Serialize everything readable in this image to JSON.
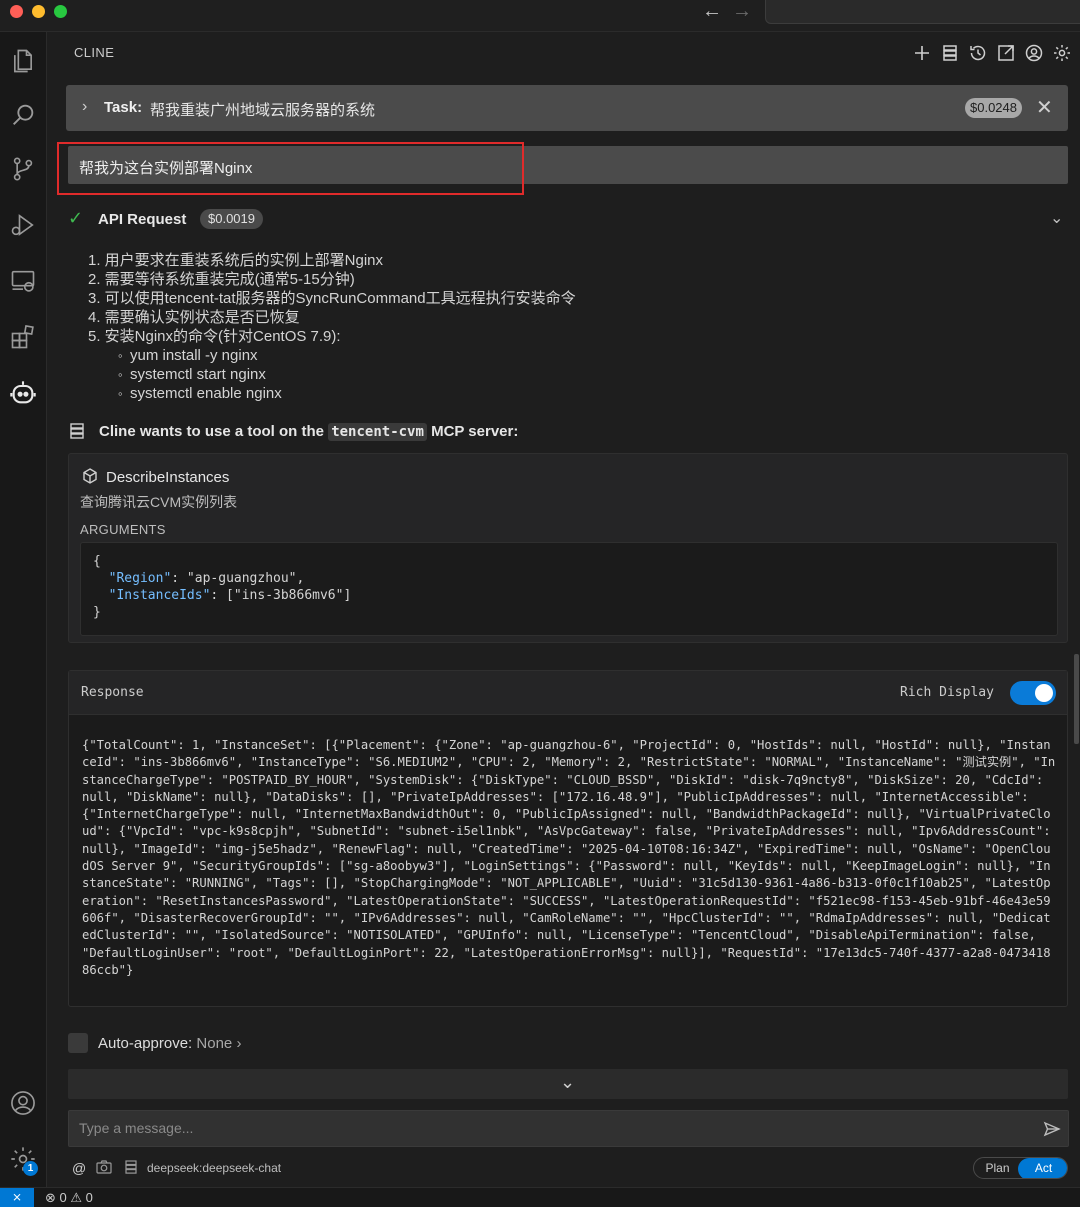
{
  "titlebar": {
    "back": "←",
    "forward": "→"
  },
  "activity_badge": "1",
  "panel": {
    "title": "CLINE"
  },
  "task": {
    "label": "Task:",
    "text": "帮我重装广州地域云服务器的系统",
    "cost": "$0.0248",
    "close": "✕"
  },
  "user_message": "帮我为这台实例部署Nginx",
  "api_request": {
    "label": "API Request",
    "cost": "$0.0019"
  },
  "steps": [
    "1. 用户要求在重装系统后的实例上部署Nginx",
    "2. 需要等待系统重装完成(通常5-15分钟)",
    "3. 可以使用tencent-tat服务器的SyncRunCommand工具远程执行安装命令",
    "4. 需要确认实例状态是否已恢复",
    "5. 安装Nginx的命令(针对CentOS 7.9):"
  ],
  "sub_steps": [
    "yum install -y nginx",
    "systemctl start nginx",
    "systemctl enable nginx"
  ],
  "tool_request": {
    "prefix": "Cline wants to use a tool on the",
    "server": "tencent-cvm",
    "suffix": "MCP server:"
  },
  "tool": {
    "name": "DescribeInstances",
    "description": "查询腾讯云CVM实例列表",
    "arguments_label": "ARGUMENTS",
    "arg_open": "{",
    "arg_close": "}",
    "arg1_key": "\"Region\"",
    "arg1_val": ": \"ap-guangzhou\",",
    "arg2_key": "\"InstanceIds\"",
    "arg2_val": ": [\"ins-3b866mv6\"]"
  },
  "response": {
    "title": "Response",
    "rich_display_label": "Rich Display",
    "rich_display_on": true,
    "body": "{\"TotalCount\": 1, \"InstanceSet\": [{\"Placement\": {\"Zone\": \"ap-guangzhou-6\", \"ProjectId\": 0, \"HostIds\": null, \"HostId\": null}, \"InstanceId\": \"ins-3b866mv6\", \"InstanceType\": \"S6.MEDIUM2\", \"CPU\": 2, \"Memory\": 2, \"RestrictState\": \"NORMAL\", \"InstanceName\": \"测试实例\", \"InstanceChargeType\": \"POSTPAID_BY_HOUR\", \"SystemDisk\": {\"DiskType\": \"CLOUD_BSSD\", \"DiskId\": \"disk-7q9ncty8\", \"DiskSize\": 20, \"CdcId\": null, \"DiskName\": null}, \"DataDisks\": [], \"PrivateIpAddresses\": [\"172.16.48.9\"], \"PublicIpAddresses\": null, \"InternetAccessible\": {\"InternetChargeType\": null, \"InternetMaxBandwidthOut\": 0, \"PublicIpAssigned\": null, \"BandwidthPackageId\": null}, \"VirtualPrivateCloud\": {\"VpcId\": \"vpc-k9s8cpjh\", \"SubnetId\": \"subnet-i5el1nbk\", \"AsVpcGateway\": false, \"PrivateIpAddresses\": null, \"Ipv6AddressCount\": null}, \"ImageId\": \"img-j5e5hadz\", \"RenewFlag\": null, \"CreatedTime\": \"2025-04-10T08:16:34Z\", \"ExpiredTime\": null, \"OsName\": \"OpenCloudOS Server 9\", \"SecurityGroupIds\": [\"sg-a8oobyw3\"], \"LoginSettings\": {\"Password\": null, \"KeyIds\": null, \"KeepImageLogin\": null}, \"InstanceState\": \"RUNNING\", \"Tags\": [], \"StopChargingMode\": \"NOT_APPLICABLE\", \"Uuid\": \"31c5d130-9361-4a86-b313-0f0c1f10ab25\", \"LatestOperation\": \"ResetInstancesPassword\", \"LatestOperationState\": \"SUCCESS\", \"LatestOperationRequestId\": \"f521ec98-f153-45eb-91bf-46e43e59606f\", \"DisasterRecoverGroupId\": \"\", \"IPv6Addresses\": null, \"CamRoleName\": \"\", \"HpcClusterId\": \"\", \"RdmaIpAddresses\": null, \"DedicatedClusterId\": \"\", \"IsolatedSource\": \"NOTISOLATED\", \"GPUInfo\": null, \"LicenseType\": \"TencentCloud\", \"DisableApiTermination\": false, \"DefaultLoginUser\": \"root\", \"DefaultLoginPort\": 22, \"LatestOperationErrorMsg\": null}], \"RequestId\": \"17e13dc5-740f-4377-a2a8-047341886ccb\"}"
  },
  "auto_approve": {
    "label": "Auto-approve:",
    "value": "None",
    "chevron": "›"
  },
  "scroll_chevron": "⌄",
  "input": {
    "placeholder": "Type a message..."
  },
  "footer": {
    "at": "@",
    "model": "deepseek:deepseek-chat",
    "plan": "Plan",
    "act": "Act"
  },
  "status": {
    "remote": "⨯",
    "problems": "⊗ 0 ⚠ 0"
  },
  "colors": {
    "accent": "#0078d4",
    "highlight": "#e02b2b",
    "success": "#3fb950"
  }
}
